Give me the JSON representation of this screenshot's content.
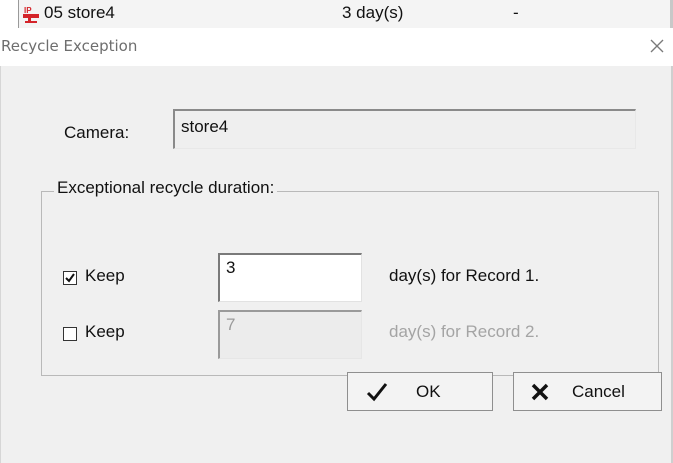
{
  "list_row": {
    "camera_name": "05 store4",
    "duration": "3 day(s)",
    "extra": "-",
    "icon": "ip-camera-icon"
  },
  "dialog": {
    "title": "Recycle Exception",
    "close_icon": "close-icon",
    "camera_label": "Camera:",
    "camera_value": "store4",
    "group_title": "Exceptional recycle duration:",
    "rows": [
      {
        "checked": true,
        "keep_label": "Keep",
        "days_value": "3",
        "suffix": "day(s) for Record 1.",
        "enabled": true
      },
      {
        "checked": false,
        "keep_label": "Keep",
        "days_value": "7",
        "suffix": "day(s) for Record 2.",
        "enabled": false
      }
    ],
    "ok_label": "OK",
    "cancel_label": "Cancel",
    "ok_icon": "checkmark-icon",
    "cancel_icon": "x-mark-icon"
  },
  "colors": {
    "dialog_bg": "#f0f0f0",
    "ip_icon_red": "#d4242a",
    "disabled_text": "#a4a4a4"
  }
}
